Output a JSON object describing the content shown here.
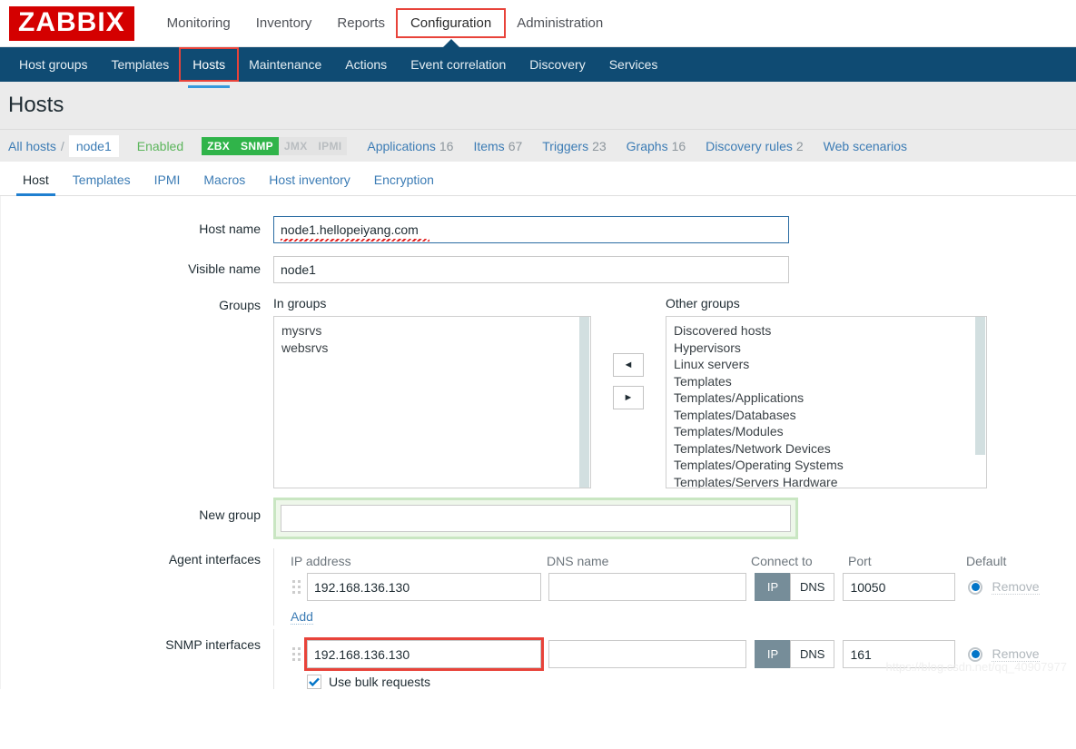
{
  "brand": {
    "logo_text": "ZABBIX",
    "logo_bg": "#d40000"
  },
  "topnav": {
    "items": [
      {
        "label": "Monitoring",
        "highlighted": false
      },
      {
        "label": "Inventory",
        "highlighted": false
      },
      {
        "label": "Reports",
        "highlighted": false
      },
      {
        "label": "Configuration",
        "highlighted": true
      },
      {
        "label": "Administration",
        "highlighted": false
      }
    ]
  },
  "subnav": {
    "items": [
      {
        "label": "Host groups"
      },
      {
        "label": "Templates"
      },
      {
        "label": "Hosts"
      },
      {
        "label": "Maintenance"
      },
      {
        "label": "Actions"
      },
      {
        "label": "Event correlation"
      },
      {
        "label": "Discovery"
      },
      {
        "label": "Services"
      }
    ],
    "active": "Hosts"
  },
  "page": {
    "title": "Hosts"
  },
  "breadcrumb": {
    "all_hosts": "All hosts",
    "separator": "/",
    "current": "node1",
    "status": "Enabled",
    "badges": [
      {
        "label": "ZBX",
        "state": "on"
      },
      {
        "label": "SNMP",
        "state": "on"
      },
      {
        "label": "JMX",
        "state": "off"
      },
      {
        "label": "IPMI",
        "state": "off"
      }
    ],
    "links": [
      {
        "label": "Applications",
        "count": "16"
      },
      {
        "label": "Items",
        "count": "67"
      },
      {
        "label": "Triggers",
        "count": "23"
      },
      {
        "label": "Graphs",
        "count": "16"
      },
      {
        "label": "Discovery rules",
        "count": "2"
      },
      {
        "label": "Web scenarios",
        "count": ""
      }
    ]
  },
  "tabs": {
    "items": [
      {
        "label": "Host"
      },
      {
        "label": "Templates"
      },
      {
        "label": "IPMI"
      },
      {
        "label": "Macros"
      },
      {
        "label": "Host inventory"
      },
      {
        "label": "Encryption"
      }
    ],
    "active": "Host"
  },
  "form": {
    "host_name": {
      "label": "Host name",
      "value": "node1.hellopeiyang.com"
    },
    "visible_name": {
      "label": "Visible name",
      "value": "node1"
    },
    "groups": {
      "label": "Groups",
      "in_groups_caption": "In groups",
      "other_groups_caption": "Other groups",
      "in_groups": [
        "mysrvs",
        "websrvs"
      ],
      "other_groups": [
        "Discovered hosts",
        "Hypervisors",
        "Linux servers",
        "Templates",
        "Templates/Applications",
        "Templates/Databases",
        "Templates/Modules",
        "Templates/Network Devices",
        "Templates/Operating Systems",
        "Templates/Servers Hardware"
      ],
      "move_left_icon": "◄",
      "move_right_icon": "►"
    },
    "new_group": {
      "label": "New group",
      "value": "",
      "placeholder": ""
    },
    "agent_interfaces": {
      "label": "Agent interfaces",
      "headers": {
        "ip": "IP address",
        "dns": "DNS name",
        "connect_to": "Connect to",
        "port": "Port",
        "default": "Default"
      },
      "rows": [
        {
          "ip": "192.168.136.130",
          "dns": "",
          "connect_ip": "IP",
          "connect_dns": "DNS",
          "connect_selected": "IP",
          "port": "10050",
          "remove_label": "Remove"
        }
      ],
      "add_label": "Add"
    },
    "snmp_interfaces": {
      "label": "SNMP interfaces",
      "rows": [
        {
          "ip": "192.168.136.130",
          "dns": "",
          "connect_ip": "IP",
          "connect_dns": "DNS",
          "connect_selected": "IP",
          "port": "161",
          "remove_label": "Remove"
        }
      ],
      "bulk_label": "Use bulk requests",
      "bulk_checked": true
    }
  },
  "watermark": {
    "text": "https://blog.csdn.net/qq_40907977"
  }
}
